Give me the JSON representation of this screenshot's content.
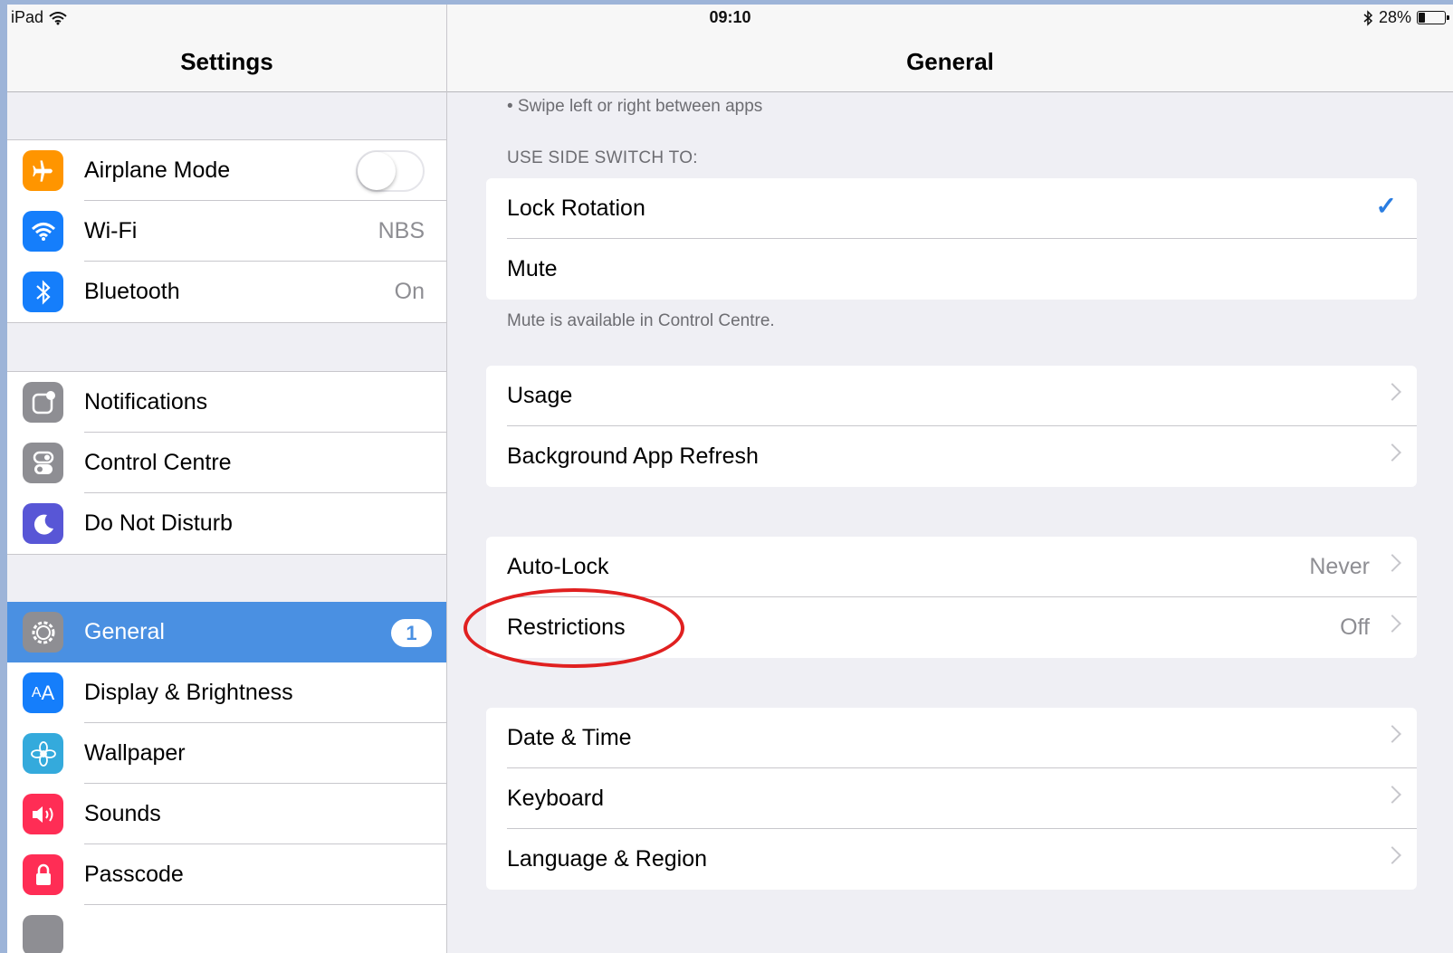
{
  "status_bar": {
    "device": "iPad",
    "time": "09:10",
    "battery_percent": "28%",
    "battery_level": 0.28
  },
  "sidebar": {
    "title": "Settings",
    "group1": [
      {
        "label": "Airplane Mode",
        "icon": "airplane-icon",
        "color": "#ff9500",
        "toggle_on": false
      },
      {
        "label": "Wi-Fi",
        "icon": "wifi-icon",
        "color": "#157efb",
        "value": "NBS"
      },
      {
        "label": "Bluetooth",
        "icon": "bluetooth-icon",
        "color": "#157efb",
        "value": "On"
      }
    ],
    "group2": [
      {
        "label": "Notifications",
        "icon": "notifications-icon",
        "color": "#8e8e93"
      },
      {
        "label": "Control Centre",
        "icon": "control-centre-icon",
        "color": "#8e8e93"
      },
      {
        "label": "Do Not Disturb",
        "icon": "moon-icon",
        "color": "#5856d6"
      }
    ],
    "group3": [
      {
        "label": "General",
        "icon": "gear-icon",
        "color": "#8e8e93",
        "badge": "1",
        "selected": true
      },
      {
        "label": "Display & Brightness",
        "icon": "display-icon",
        "color": "#157efb"
      },
      {
        "label": "Wallpaper",
        "icon": "wallpaper-icon",
        "color": "#34aadc"
      },
      {
        "label": "Sounds",
        "icon": "sounds-icon",
        "color": "#ff2d55"
      },
      {
        "label": "Passcode",
        "icon": "lock-icon",
        "color": "#ff2d55"
      }
    ]
  },
  "general": {
    "title": "General",
    "top_note": "• Swipe left or right between apps",
    "side_switch_header": "USE SIDE SWITCH TO:",
    "side_switch": [
      {
        "label": "Lock Rotation",
        "checked": true
      },
      {
        "label": "Mute",
        "checked": false
      }
    ],
    "side_switch_footer": "Mute is available in Control Centre.",
    "group_usage": [
      {
        "label": "Usage"
      },
      {
        "label": "Background App Refresh"
      }
    ],
    "group_lock": [
      {
        "label": "Auto-Lock",
        "value": "Never"
      },
      {
        "label": "Restrictions",
        "value": "Off"
      }
    ],
    "group_locale": [
      {
        "label": "Date & Time"
      },
      {
        "label": "Keyboard"
      },
      {
        "label": "Language & Region"
      }
    ],
    "accent": "#e02020"
  }
}
